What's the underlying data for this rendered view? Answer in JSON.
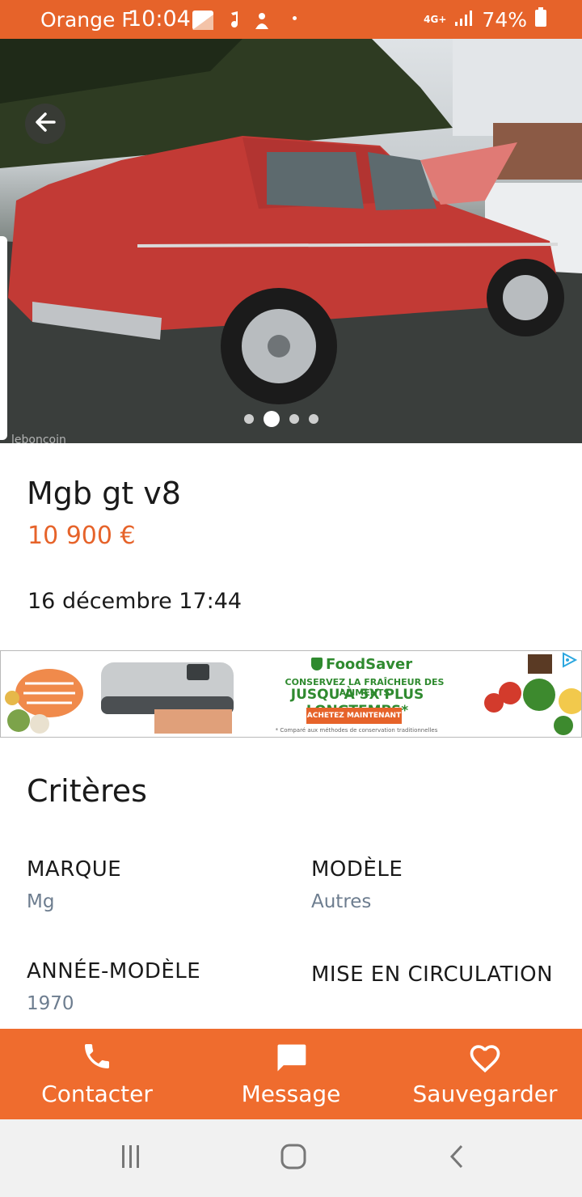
{
  "status_bar": {
    "carrier": "Orange F",
    "time": "10:04",
    "network": "4G+",
    "battery": "74%"
  },
  "colors": {
    "accent": "#e6632a",
    "action_bar": "#ef6c2e",
    "criteria_value": "#6d7d8f"
  },
  "gallery": {
    "image_count": 4,
    "active_index": 2,
    "watermark": "leboncoin"
  },
  "listing": {
    "title": "Mgb gt v8",
    "price": "10 900 €",
    "date": "16 décembre 17:44"
  },
  "ad": {
    "brand": "FoodSaver",
    "line1": "CONSERVEZ LA FRAÎCHEUR DES ALIMENTS",
    "line2": "JUSQU'À 5X PLUS LONGTEMPS*",
    "cta": "ACHETEZ MAINTENANT",
    "note": "* Comparé aux méthodes de conservation traditionnelles"
  },
  "criteria": {
    "title": "Critères",
    "items": [
      {
        "label": "MARQUE",
        "value": "Mg"
      },
      {
        "label": "MODÈLE",
        "value": "Autres"
      },
      {
        "label": "ANNÉE-MODÈLE",
        "value": "1970"
      },
      {
        "label": "MISE EN CIRCULATION",
        "value": ""
      }
    ]
  },
  "actions": {
    "contact": {
      "label": "Contacter",
      "icon": "phone-icon"
    },
    "message": {
      "label": "Message",
      "icon": "chat-icon"
    },
    "save": {
      "label": "Sauvegarder",
      "icon": "heart-icon"
    }
  },
  "nav": {
    "recent": "recent-apps-icon",
    "home": "home-icon",
    "back": "back-icon"
  }
}
